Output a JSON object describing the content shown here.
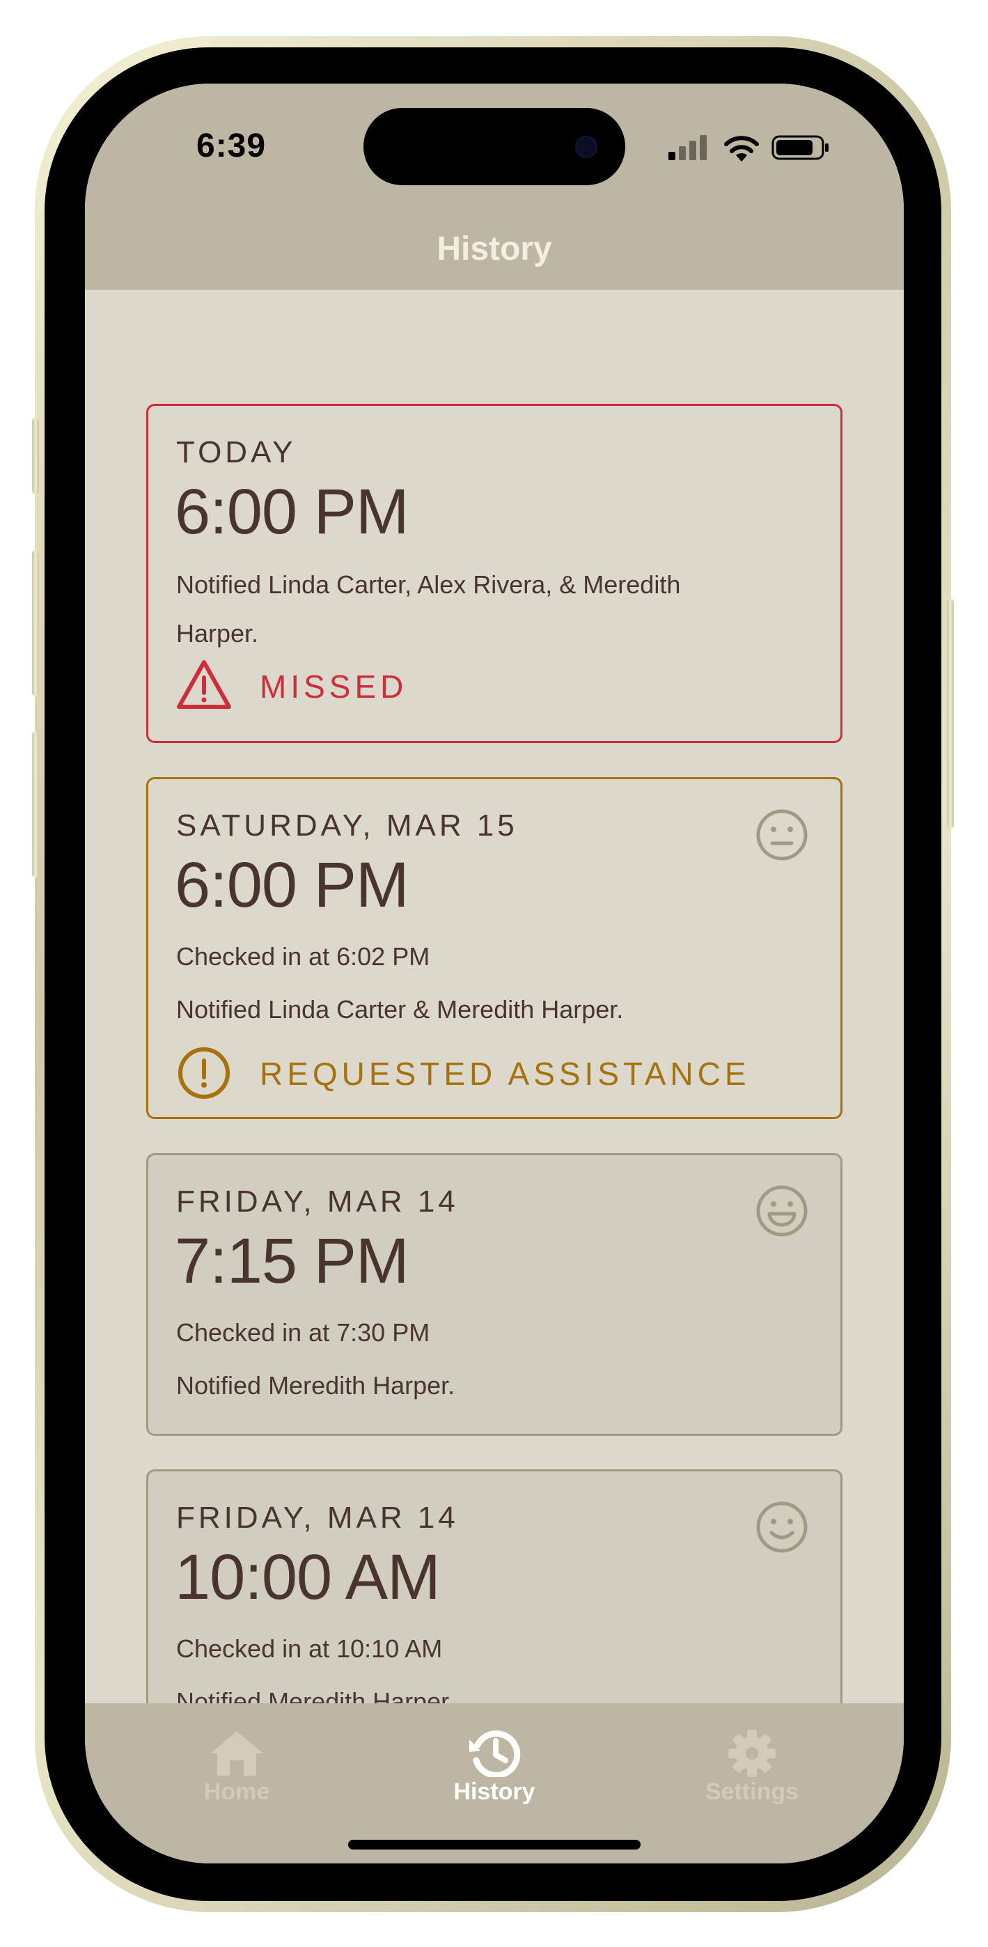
{
  "status_bar": {
    "time": "6:39"
  },
  "nav": {
    "title": "History"
  },
  "entries": [
    {
      "date": "TODAY",
      "time": "6:00 PM",
      "lines": [
        "Notified Linda Carter, Alex Rivera, & Meredith Harper."
      ],
      "status": "MISSED",
      "status_icon": "warning-triangle-icon",
      "color": "#cc2e3c"
    },
    {
      "date": "SATURDAY, MAR 15",
      "time": "6:00 PM",
      "lines": [
        "Checked in at 6:02 PM",
        "Notified Linda Carter & Meredith Harper."
      ],
      "status": "REQUESTED ASSISTANCE",
      "status_icon": "exclamation-circle-icon",
      "mood_icon": "neutral-face-icon",
      "color": "#a6720e"
    },
    {
      "date": "FRIDAY, MAR 14",
      "time": "7:15 PM",
      "lines": [
        "Checked in at 7:30 PM",
        "Notified Meredith Harper."
      ],
      "mood_icon": "grinning-face-icon"
    },
    {
      "date": "FRIDAY, MAR 14",
      "time": "10:00 AM",
      "lines": [
        "Checked in at 10:10 AM",
        "Notified Meredith Harper."
      ],
      "mood_icon": "smiling-face-icon"
    }
  ],
  "tabs": [
    {
      "label": "Home",
      "icon": "house-icon",
      "active": false
    },
    {
      "label": "History",
      "icon": "history-clock-icon",
      "active": true
    },
    {
      "label": "Settings",
      "icon": "gear-icon",
      "active": false
    }
  ],
  "colors": {
    "background": "#dcd9cc",
    "bar": "#bcb6a2",
    "text": "#4a3430",
    "missed": "#cc2e3c",
    "assistance": "#a6720e",
    "icon_muted": "#9e9a83"
  }
}
